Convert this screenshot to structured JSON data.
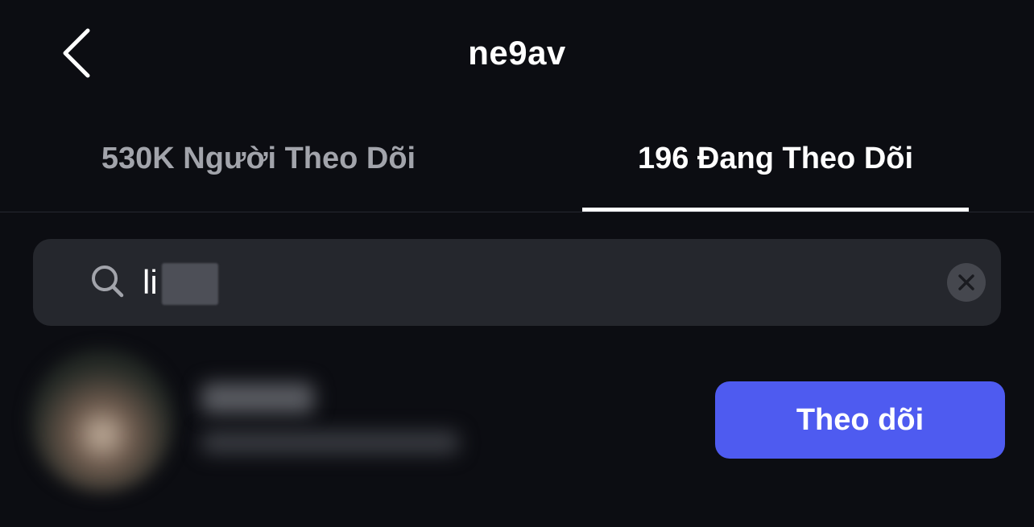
{
  "header": {
    "title": "ne9av",
    "back_icon": "chevron-left-icon"
  },
  "tabs": [
    {
      "label": "530K Người Theo Dõi",
      "active": false
    },
    {
      "label": "196 Đang Theo Dõi",
      "active": true
    }
  ],
  "search": {
    "value": "li",
    "search_icon": "search-icon",
    "clear_icon": "close-icon"
  },
  "results": [
    {
      "button_label": "Theo dõi"
    }
  ],
  "colors": {
    "background": "#0c0d12",
    "search_bg": "#25272d",
    "accent": "#4e5bf0",
    "inactive_tab": "#a2a4ab"
  }
}
